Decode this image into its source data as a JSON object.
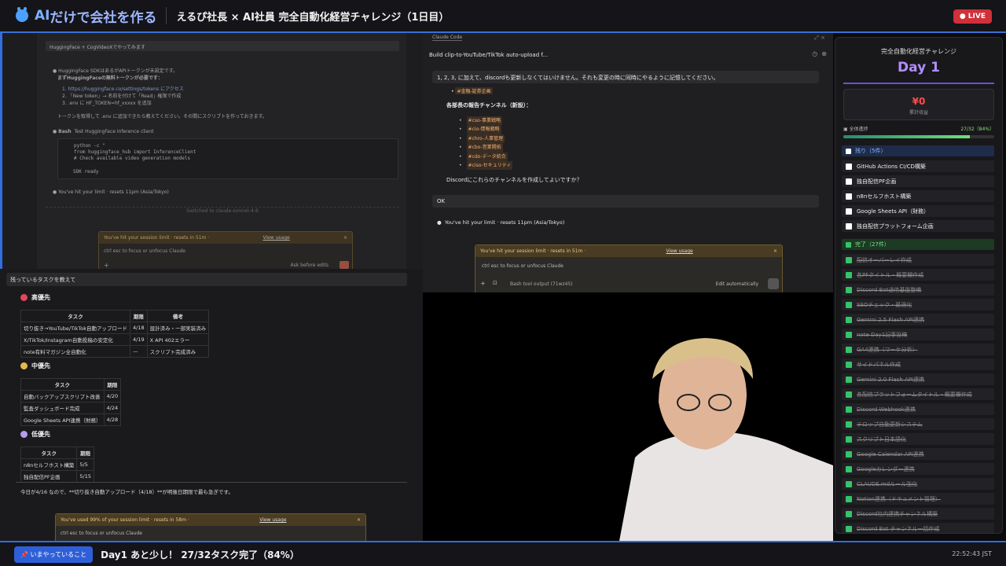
{
  "header": {
    "brand_ai": "AI",
    "brand_rest": "だけで会社を作る",
    "stream_title": "えるぴ社長 × AI社員 完全自動化経営チャレンジ（1日目）",
    "live": "● LIVE"
  },
  "left_top": {
    "tab": "HuggingFace + CogVideoXでやってみます",
    "line1": "HuggingFace SDKはあるがAPIトークンが未設定です。",
    "line2": "まずHuggingFaceの無料トークンが必要です：",
    "steps": [
      "1. https://huggingface.co/settings/tokens にアクセス",
      "2. 「New token」→ 名前を付けて「Read」権限で作成",
      "3. .env に HF_TOKEN=hf_xxxxx を追加"
    ],
    "line3": "トークンを取得して .env に追加できたら教えてください。その間にスクリプトを作っておきます。",
    "bash_label": "Bash",
    "bash_desc": "Test HuggingFace Inference client",
    "code": [
      "python -c \"",
      "from huggingface_hub import InferenceClient",
      "# Check available video generation models"
    ],
    "sdk_ready": "SDK ready",
    "limit_line": "You've hit your limit · resets 11pm (Asia/Tokyo)",
    "switched": "Switched to claude-sonnet-4-6",
    "limit_box": {
      "head": "You've hit your session limit · resets in 51m ·",
      "link": "View usage",
      "body": "ctrl esc to focus or unfocus Claude",
      "footer": "Ask before edits"
    }
  },
  "left_bottom": {
    "question": "残っているタスクを教えて",
    "high": "高優先",
    "high_table": {
      "headers": [
        "タスク",
        "期限",
        "備考"
      ],
      "rows": [
        [
          "切り抜き→YouTube/TikTok自動アップロード",
          "4/18",
          "設計済み・一部実装済み"
        ],
        [
          "X/TikTok/Instagram自動投稿の安定化",
          "4/19",
          "X API 402エラー"
        ],
        [
          "note有料マガジン全自動化",
          "—",
          "スクリプト完成済み"
        ]
      ]
    },
    "mid": "中優先",
    "mid_table": {
      "headers": [
        "タスク",
        "期限"
      ],
      "rows": [
        [
          "自動バックアップスクリプト改善",
          "4/20"
        ],
        [
          "監査ダッシュボード完成",
          "4/24"
        ],
        [
          "Google Sheets API連携（財務）",
          "4/28"
        ]
      ]
    },
    "low": "低優先",
    "low_table": {
      "headers": [
        "タスク",
        "期限"
      ],
      "rows": [
        [
          "n8nセルフホスト構築",
          "5/5"
        ],
        [
          "独自配信PF企画",
          "5/15"
        ]
      ]
    },
    "summary": "今日が4/16 なので、**切り抜き自動アップロード（4/18）**が明後日期限で最も急ぎです。",
    "limit_box": {
      "head": "You've used 99% of your session limit · resets in 58m ·",
      "link": "View usage",
      "body": "ctrl esc to focus or unfocus Claude"
    }
  },
  "mid_chat": {
    "header_tab": "Claude Code",
    "title": "Build clip-to-YouTube/TikTok auto-upload f...",
    "user_msg": "1, 2, 3, に加えて、discordも更新しなくてはいけません。それも変更の時に同時にやるように記憶してください。",
    "item_top": "#金融-証券企画",
    "section": "各部長の報告チャンネル（新設）：",
    "channels": [
      "#cso-事業戦略",
      "#cio-情報戦略",
      "#chro-人事管理",
      "#cbo-営業開拓",
      "#cdo-データ統合",
      "#ciso-セキュリティ"
    ],
    "ask": "Discordにこれらのチャンネルを作成してよいですか？",
    "ok": "OK",
    "limit_line": "You've hit your limit · resets 11pm (Asia/Tokyo)",
    "limit_box": {
      "head": "You've hit your session limit · resets in 51m ·",
      "link": "View usage",
      "body": "ctrl esc to focus or unfocus Claude",
      "footer_left": "Bash tool output (71wz45)",
      "footer_right": "Edit automatically"
    }
  },
  "right": {
    "title": "完全自動化経営チャレンジ",
    "day": "Day 1",
    "revenue": "¥0",
    "revenue_label": "累計収益",
    "progress_label": "全体進捗",
    "progress_value": "27/32（84%）",
    "progress_fraction": 0.84,
    "remaining_head": "残り（5件）",
    "remaining": [
      "GitHub Actions CI/CD構築",
      "独自配信PF企画",
      "n8nセルフホスト構築",
      "Google Sheets API（財務）",
      "独自配信プラットフォーム企画"
    ],
    "done_head": "完了（27件）",
    "done": [
      "配信オーバーレイ作成",
      "各PFタイトル・概要欄作成",
      "Discord Bot通信基盤整備",
      "SEOチェック・最適化",
      "Gemini 2.5 Flash API連携",
      "note Day1記事投稿",
      "GA4連携（マーケ分析）",
      "サイドパネル作成",
      "Gemini 2.0 Flash API連携",
      "各配信プラットフォームタイトル・概要欄作成",
      "Discord Webhook連携",
      "テロップ自動更新システム",
      "スクリプト日本語化",
      "Google Calendar API連携",
      "Googleカレンダー連携",
      "CLAUDE.mdルール強化",
      "Notion連携（ドキュメント管理）",
      "Discord社内連携チャンネル構築",
      "Discord Bot チャンネル一括作成"
    ]
  },
  "bottom": {
    "badge": "📌 いまやっていること",
    "now": "Day1 あと少し！ 27/32タスク完了（84%）",
    "clock": "22:52:43 JST"
  }
}
